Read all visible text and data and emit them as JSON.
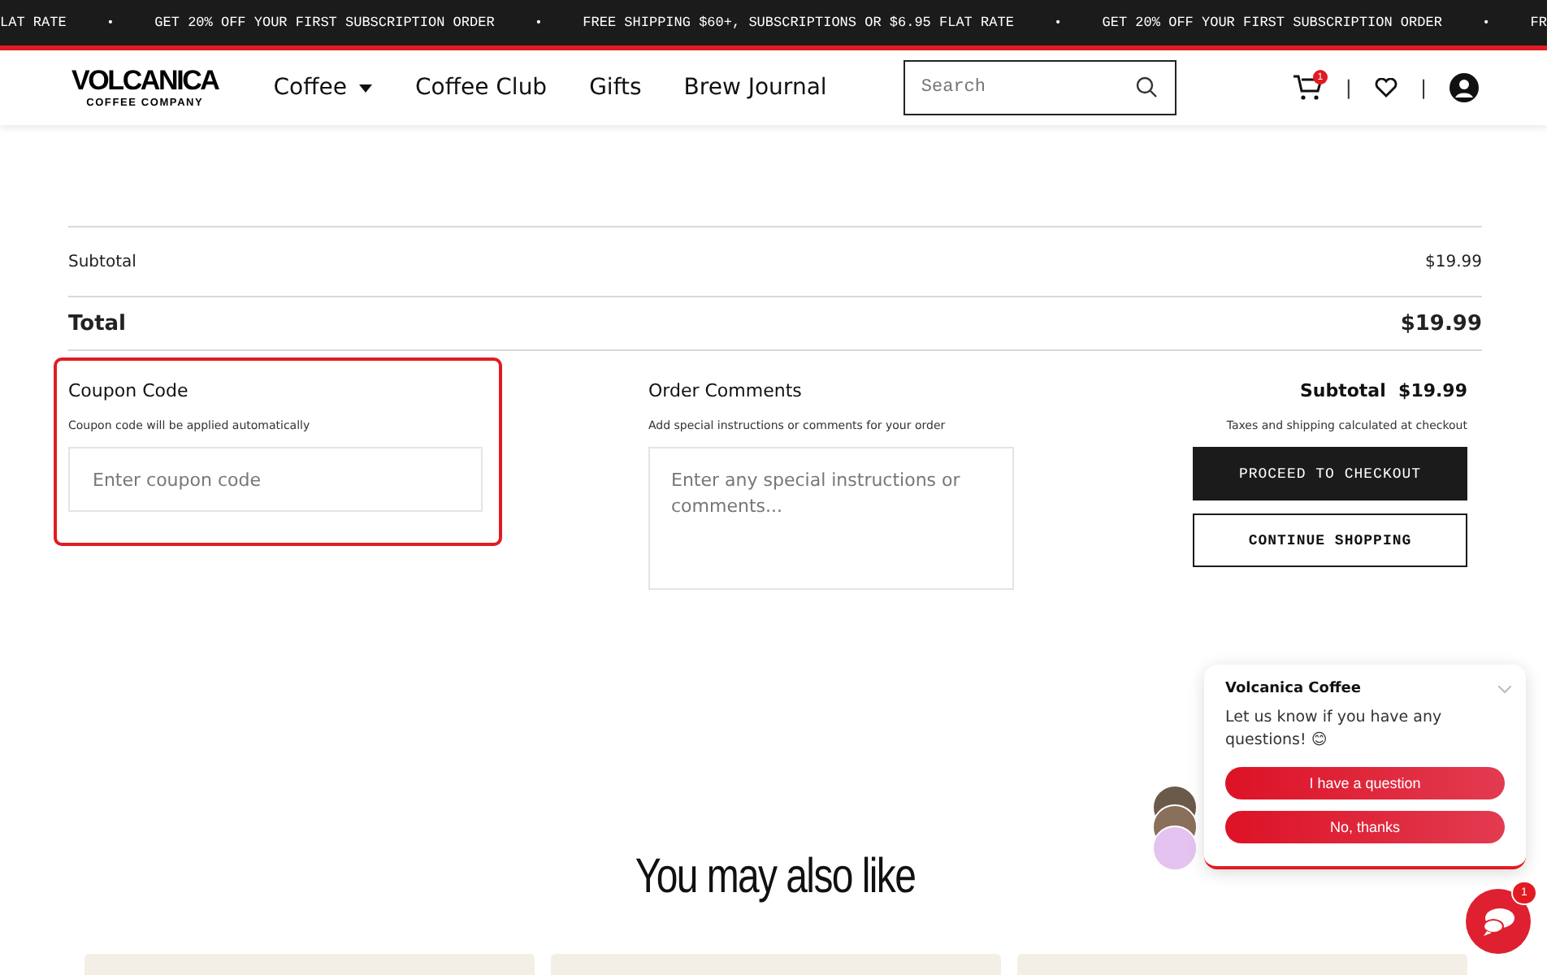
{
  "announcement_bar": {
    "items": [
      {
        "kind": "text",
        "text": "LAT RATE"
      },
      {
        "kind": "bullet",
        "text": "•"
      },
      {
        "kind": "text",
        "text": "GET 20% OFF YOUR FIRST SUBSCRIPTION ORDER"
      },
      {
        "kind": "bullet",
        "text": "•"
      },
      {
        "kind": "text",
        "text": "FREE SHIPPING $60+, SUBSCRIPTIONS OR $6.95 FLAT RATE"
      },
      {
        "kind": "bullet",
        "text": "•"
      },
      {
        "kind": "text",
        "text": "GET 20% OFF YOUR FIRST SUBSCRIPTION ORDER"
      },
      {
        "kind": "bullet",
        "text": "•"
      },
      {
        "kind": "text",
        "text": "FR"
      }
    ]
  },
  "header": {
    "logo": {
      "title": "VOLCANICA",
      "subtitle": "COFFEE COMPANY"
    },
    "nav": [
      {
        "label": "Coffee",
        "has_dropdown": true
      },
      {
        "label": "Coffee Club",
        "has_dropdown": false
      },
      {
        "label": "Gifts",
        "has_dropdown": false
      },
      {
        "label": "Brew Journal",
        "has_dropdown": false
      }
    ],
    "search": {
      "placeholder": "Search"
    },
    "cart_count": "1",
    "separators": [
      "|",
      "|"
    ]
  },
  "summary": {
    "subtotal": {
      "label": "Subtotal",
      "value": "$19.99"
    },
    "total": {
      "label": "Total",
      "value": "$19.99"
    }
  },
  "coupon": {
    "title": "Coupon Code",
    "hint": "Coupon code will be applied automatically",
    "placeholder": "Enter coupon code",
    "highlighted": true
  },
  "comments": {
    "title": "Order Comments",
    "hint": "Add special instructions or comments for your order",
    "placeholder": "Enter any special instructions or comments..."
  },
  "checkout": {
    "subtotal_label": "Subtotal",
    "subtotal_value": "$19.99",
    "note": "Taxes and shipping calculated at checkout",
    "buttons": [
      {
        "label": "PROCEED TO CHECKOUT",
        "kind": "primary"
      },
      {
        "label": "CONTINUE SHOPPING",
        "kind": "secondary"
      }
    ]
  },
  "chat": {
    "title": "Volcanica Coffee",
    "message": "Let us know if you have any questions! 😊",
    "buttons": [
      "I have a question",
      "No, thanks"
    ],
    "badge": "1"
  },
  "recommendations": {
    "title": "You may also like"
  }
}
